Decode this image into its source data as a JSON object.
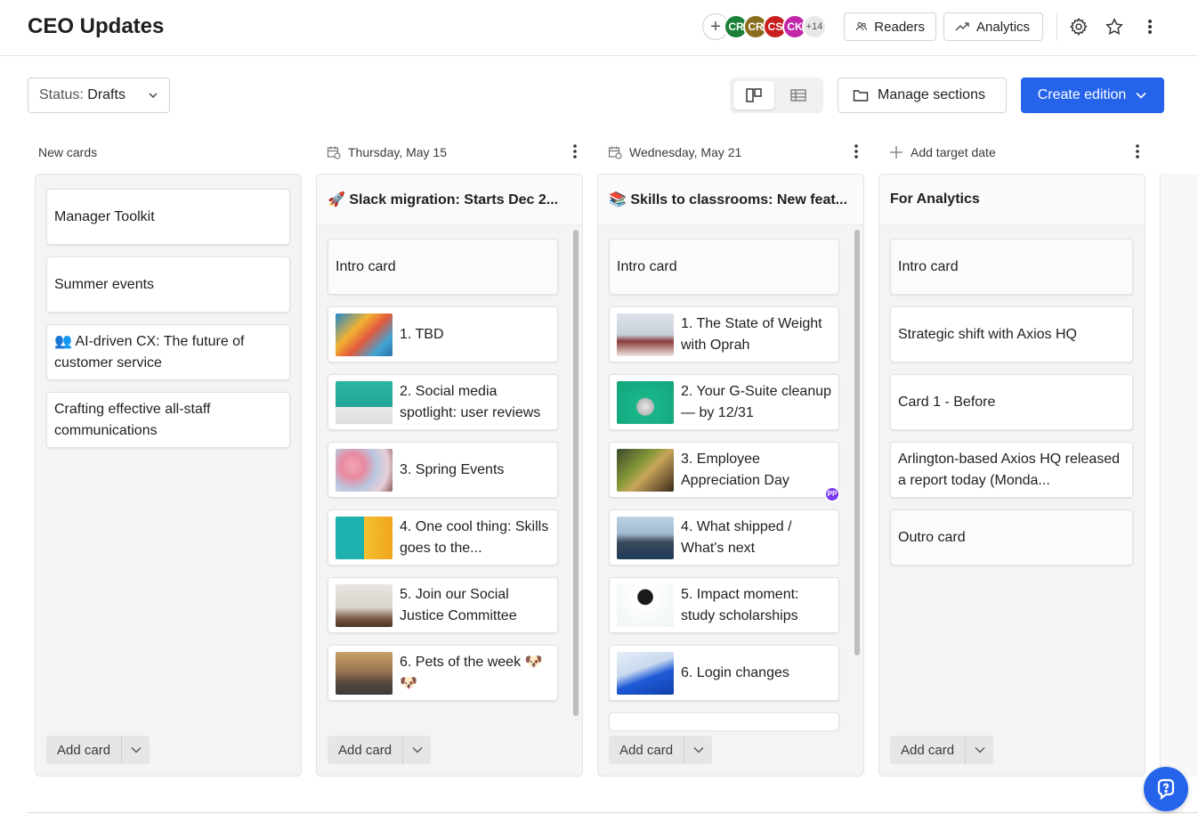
{
  "header": {
    "title": "CEO Updates",
    "avatars": [
      {
        "initials": "CR",
        "color": "#1a7f37"
      },
      {
        "initials": "CR",
        "color": "#8a6d1c"
      },
      {
        "initials": "CS",
        "color": "#c81e1e"
      },
      {
        "initials": "CK",
        "color": "#c026a8"
      }
    ],
    "avatars_more": "+14",
    "readers_label": "Readers",
    "analytics_label": "Analytics"
  },
  "toolbar": {
    "status_label": "Status:",
    "status_value": "Drafts",
    "manage_sections_label": "Manage sections",
    "create_edition_label": "Create edition"
  },
  "columns": [
    {
      "header": "New cards",
      "title": "",
      "cards": [
        {
          "text": "Manager Toolkit"
        },
        {
          "text": "Summer events"
        },
        {
          "text": "👥 AI-driven CX: The future of customer service"
        },
        {
          "text": "Crafting effective all-staff communications"
        }
      ],
      "add_label": "Add card"
    },
    {
      "header": "Thursday, May 15",
      "title": "🚀 Slack migration: Starts Dec 2...",
      "cards": [
        {
          "text": "Intro card"
        },
        {
          "text": "1. TBD"
        },
        {
          "text": "2. Social media spotlight: user reviews"
        },
        {
          "text": "3. Spring Events"
        },
        {
          "text": "4. One cool thing: Skills goes to the..."
        },
        {
          "text": "5. Join our Social Justice Committee"
        },
        {
          "text": "6. Pets of the week 🐶 🐶"
        }
      ],
      "add_label": "Add card"
    },
    {
      "header": "Wednesday, May 21",
      "title": "📚 Skills to classrooms: New feat...",
      "cards": [
        {
          "text": "Intro card"
        },
        {
          "text": "1. The State of Weight with Oprah"
        },
        {
          "text": "2. Your G-Suite cleanup — by 12/31"
        },
        {
          "text": "3. Employee Appreciation Day",
          "badge": "PP"
        },
        {
          "text": "4. What shipped / What's next"
        },
        {
          "text": "5. Impact moment: study scholarships"
        },
        {
          "text": "6. Login changes"
        }
      ],
      "add_label": "Add card"
    },
    {
      "header": "Add target date",
      "title": "For Analytics",
      "cards": [
        {
          "text": "Intro card"
        },
        {
          "text": "Strategic shift with Axios HQ"
        },
        {
          "text": "Card 1 - Before"
        },
        {
          "text": "Arlington-based Axios HQ released a report today (Monda..."
        },
        {
          "text": "Outro card"
        }
      ],
      "add_label": "Add card"
    }
  ],
  "colors": {
    "accent": "#2563eb",
    "badge": "#7c3aed"
  }
}
